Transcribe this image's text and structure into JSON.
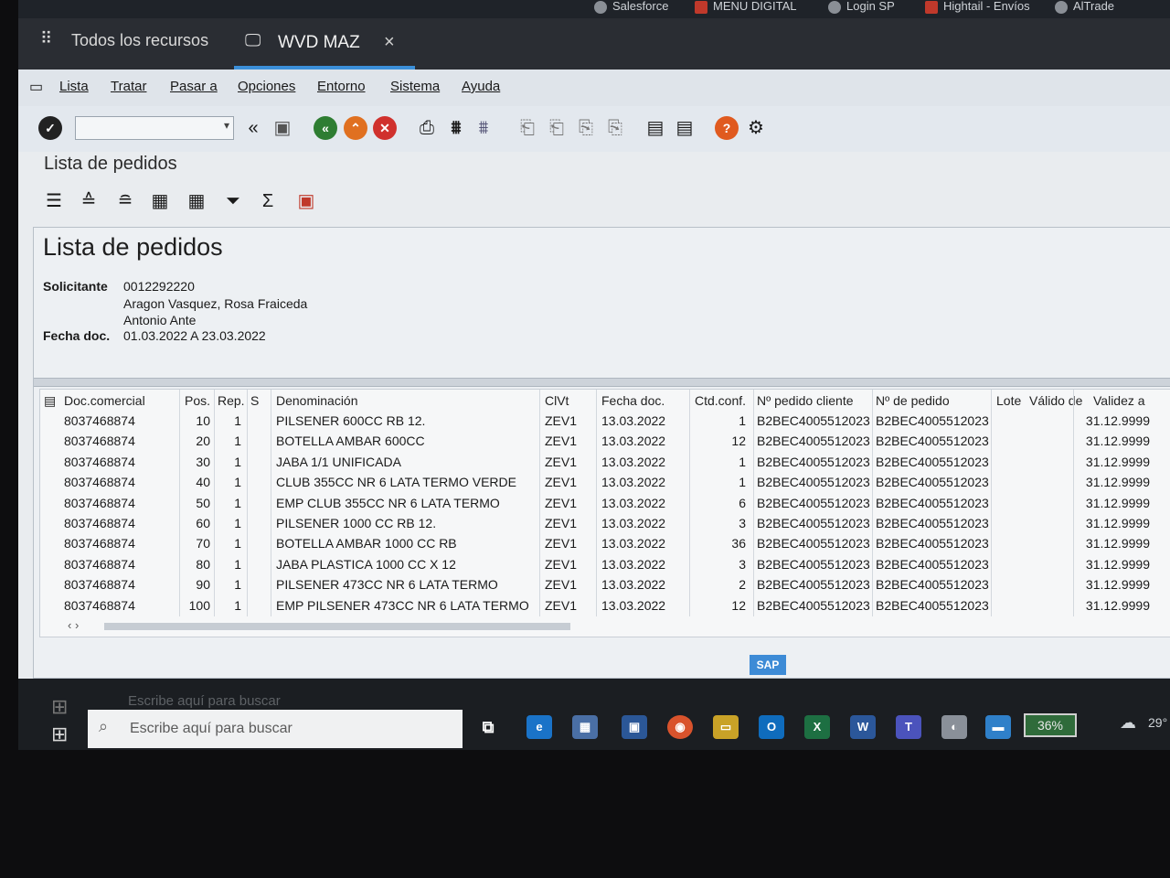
{
  "bookmarks": [
    {
      "label": "Salesforce"
    },
    {
      "label": "MENU DIGITAL"
    },
    {
      "label": "Login SP"
    },
    {
      "label": "Hightail - Envíos"
    },
    {
      "label": "AlTrade"
    }
  ],
  "tabs": {
    "resources": "Todos los recursos",
    "active": "WVD MAZ",
    "close": "×"
  },
  "menu": [
    "Lista",
    "Tratar",
    "Pasar a",
    "Opciones",
    "Entorno",
    "Sistema",
    "Ayuda"
  ],
  "screen_title": "Lista de pedidos",
  "report": {
    "title": "Lista de pedidos",
    "solicitante_label": "Solicitante",
    "solicitante_value": "0012292220",
    "name_line1": "Aragon Vasquez, Rosa Fraiceda",
    "name_line2": "Antonio Ante",
    "fecha_label": "Fecha doc.",
    "fecha_value": "01.03.2022 A 23.03.2022"
  },
  "grid": {
    "headers": [
      "Doc.comercial",
      "Pos.",
      "Rep.",
      "S",
      "Denominación",
      "ClVt",
      "Fecha doc.",
      "Ctd.conf.",
      "Nº pedido cliente",
      "Nº de pedido",
      "Lote",
      "Válido de",
      "Validez a"
    ],
    "rows": [
      [
        "8037468874",
        "10",
        "1",
        "PILSENER 600CC RB 12.",
        "ZEV1",
        "13.03.2022",
        "1",
        "B2BEC4005512023",
        "B2BEC4005512023",
        "31.12.9999"
      ],
      [
        "8037468874",
        "20",
        "1",
        "BOTELLA AMBAR 600CC",
        "ZEV1",
        "13.03.2022",
        "12",
        "B2BEC4005512023",
        "B2BEC4005512023",
        "31.12.9999"
      ],
      [
        "8037468874",
        "30",
        "1",
        "JABA 1/1 UNIFICADA",
        "ZEV1",
        "13.03.2022",
        "1",
        "B2BEC4005512023",
        "B2BEC4005512023",
        "31.12.9999"
      ],
      [
        "8037468874",
        "40",
        "1",
        "CLUB 355CC NR 6 LATA TERMO VERDE",
        "ZEV1",
        "13.03.2022",
        "1",
        "B2BEC4005512023",
        "B2BEC4005512023",
        "31.12.9999"
      ],
      [
        "8037468874",
        "50",
        "1",
        "EMP CLUB 355CC NR 6 LATA TERMO",
        "ZEV1",
        "13.03.2022",
        "6",
        "B2BEC4005512023",
        "B2BEC4005512023",
        "31.12.9999"
      ],
      [
        "8037468874",
        "60",
        "1",
        "PILSENER 1000 CC RB 12.",
        "ZEV1",
        "13.03.2022",
        "3",
        "B2BEC4005512023",
        "B2BEC4005512023",
        "31.12.9999"
      ],
      [
        "8037468874",
        "70",
        "1",
        "BOTELLA AMBAR 1000 CC RB",
        "ZEV1",
        "13.03.2022",
        "36",
        "B2BEC4005512023",
        "B2BEC4005512023",
        "31.12.9999"
      ],
      [
        "8037468874",
        "80",
        "1",
        "JABA PLASTICA 1000 CC X 12",
        "ZEV1",
        "13.03.2022",
        "3",
        "B2BEC4005512023",
        "B2BEC4005512023",
        "31.12.9999"
      ],
      [
        "8037468874",
        "90",
        "1",
        "PILSENER 473CC NR 6 LATA TERMO",
        "ZEV1",
        "13.03.2022",
        "2",
        "B2BEC4005512023",
        "B2BEC4005512023",
        "31.12.9999"
      ],
      [
        "8037468874",
        "100",
        "1",
        "EMP PILSENER 473CC NR 6 LATA TERMO",
        "ZEV1",
        "13.03.2022",
        "12",
        "B2BEC4005512023",
        "B2BEC4005512023",
        "31.12.9999"
      ]
    ]
  },
  "taskbar": {
    "search_placeholder": "Escribe aquí para buscar",
    "battery": "36%",
    "temperature": "29°"
  },
  "sap_logo": "SAP",
  "colors": {
    "accent": "#3b8fd9",
    "help": "#e05a1f",
    "cancel": "#d0312d",
    "back": "#2e7d32"
  }
}
